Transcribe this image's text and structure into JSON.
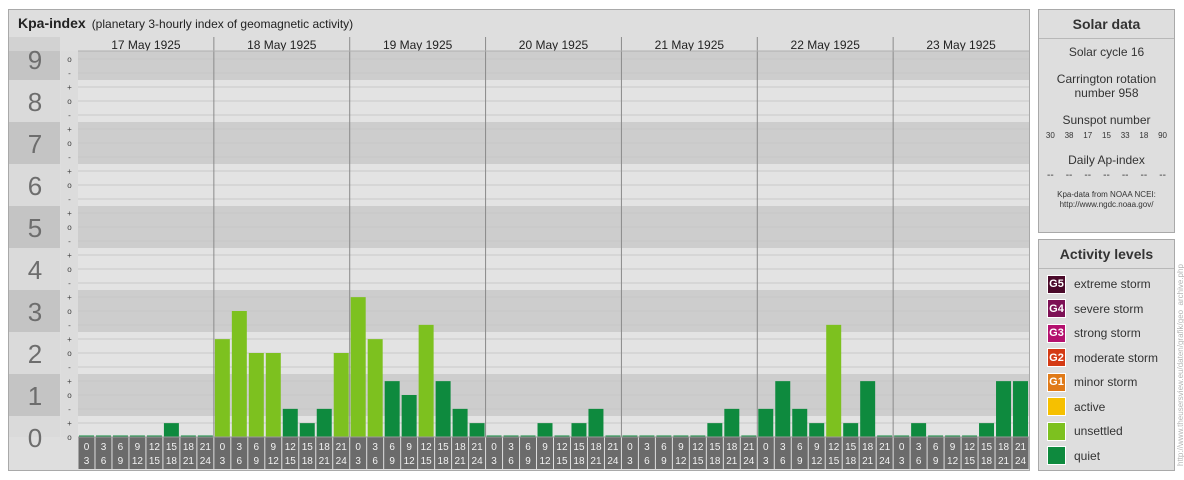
{
  "header": {
    "title": "Kpa-index",
    "subtitle": "(planetary 3-hourly index of geomagnetic activity)"
  },
  "solar": {
    "title": "Solar data",
    "cycle": "Solar cycle 16",
    "carrington_line1": "Carrington rotation",
    "carrington_line2": "number 958",
    "sunspot_title": "Sunspot number",
    "sunspot_values": [
      "30",
      "38",
      "17",
      "15",
      "33",
      "18",
      "90"
    ],
    "ap_title": "Daily Ap-index",
    "ap_values": [
      "--",
      "--",
      "--",
      "--",
      "--",
      "--",
      "--"
    ],
    "credit_line1": "Kpa-data from NOAA NCEI:",
    "credit_line2": "http://www.ngdc.noaa.gov/"
  },
  "levels": {
    "title": "Activity levels",
    "items": [
      {
        "code": "G5",
        "label": "extreme storm",
        "color": "#4a0a2a"
      },
      {
        "code": "G4",
        "label": "severe storm",
        "color": "#7d1055"
      },
      {
        "code": "G3",
        "label": "strong storm",
        "color": "#b4106e"
      },
      {
        "code": "G2",
        "label": "moderate storm",
        "color": "#d43a14"
      },
      {
        "code": "G1",
        "label": "minor storm",
        "color": "#e07a18"
      },
      {
        "code": "",
        "label": "active",
        "color": "#f6c000"
      },
      {
        "code": "",
        "label": "unsettled",
        "color": "#7dc11f"
      },
      {
        "code": "",
        "label": "quiet",
        "color": "#0e8a3e"
      }
    ]
  },
  "watermark": "http://www.theusersview.eu/daten/grafik/geo_archive.php",
  "chart_data": {
    "type": "bar",
    "title": "Kpa-index",
    "ylim": [
      0,
      9.33
    ],
    "y_ticks": [
      "0",
      "1",
      "2",
      "3",
      "4",
      "5",
      "6",
      "7",
      "8",
      "9"
    ],
    "y_subticks": [
      "o",
      "+",
      "-",
      "o",
      "+",
      "-",
      "o",
      "+",
      "-",
      "o",
      "+",
      "-",
      "o",
      "+",
      "-",
      "o",
      "+",
      "-",
      "o",
      "+",
      "-",
      "o",
      "+",
      "-",
      "o",
      "+",
      "-",
      "o"
    ],
    "days": [
      "17 May 1925",
      "18 May 1925",
      "19 May 1925",
      "20 May 1925",
      "21 May 1925",
      "22 May 1925",
      "23 May 1925"
    ],
    "interval_top": [
      "0",
      "3",
      "6",
      "9",
      "12",
      "15",
      "18",
      "21"
    ],
    "interval_bottom": [
      "3",
      "6",
      "9",
      "12",
      "15",
      "18",
      "21",
      "24"
    ],
    "values": [
      [
        0,
        0,
        0,
        0,
        0,
        0.33,
        0,
        0
      ],
      [
        2.33,
        3,
        2,
        2,
        0.67,
        0.33,
        0.67,
        2
      ],
      [
        3.33,
        2.33,
        1.33,
        1,
        2.67,
        1.33,
        0.67,
        0.33
      ],
      [
        0,
        0,
        0,
        0.33,
        0,
        0.33,
        0.67,
        0
      ],
      [
        0,
        0,
        0,
        0,
        0,
        0.33,
        0.67,
        0
      ],
      [
        0.67,
        1.33,
        0.67,
        0.33,
        2.67,
        0.33,
        1.33,
        0
      ],
      [
        0,
        0.33,
        0,
        0,
        0,
        0.33,
        1.33,
        1.33
      ]
    ],
    "colors": {
      "quiet": "#0e8a3e",
      "unsettled": "#7dc11f",
      "active": "#f6c000"
    }
  }
}
